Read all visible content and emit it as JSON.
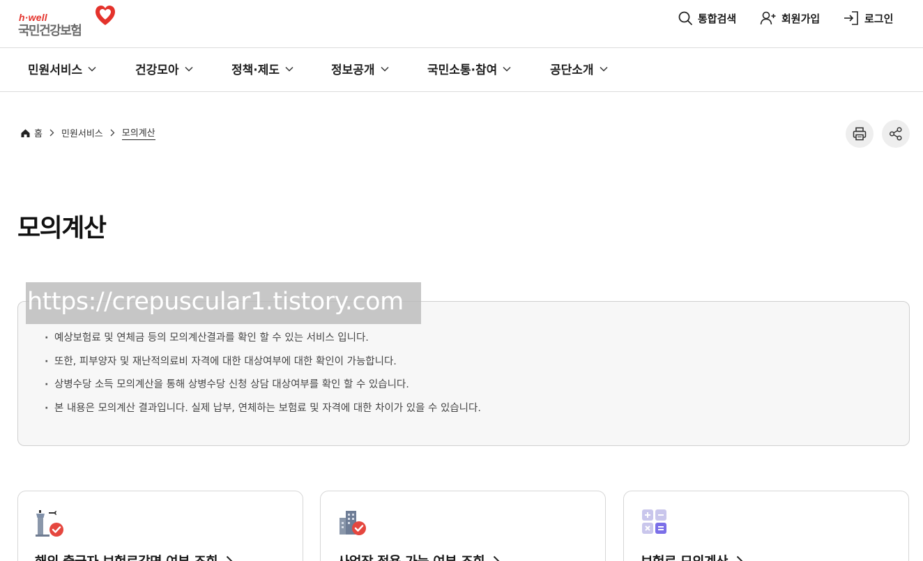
{
  "logo": {
    "sub": "h·well",
    "name": "국민건강보험"
  },
  "util": {
    "search": "통합검색",
    "join": "회원가입",
    "login": "로그인"
  },
  "gnb": [
    "민원서비스",
    "건강모아",
    "정책·제도",
    "정보공개",
    "국민소통·참여",
    "공단소개"
  ],
  "breadcrumb": {
    "home": "홈",
    "level1": "민원서비스",
    "current": "모의계산"
  },
  "page": {
    "title": "모의계산"
  },
  "watermark": "https://crepuscular1.tistory.com",
  "info": [
    "예상보험료 및 연체금 등의 모의계산결과를 확인 할 수 있는 서비스 입니다.",
    "또한, 피부양자 및 재난적의료비 자격에 대한 대상여부에 대한 확인이 가능합니다.",
    "상병수당 소득 모의계산을 통해 상병수당 신청 상담 대상여부를 확인 할 수 있습니다.",
    "본 내용은 모의계산 결과입니다. 실제 납부, 연체하는 보험료 및 자격에 대한 차이가 있을 수 있습니다."
  ],
  "cards": [
    {
      "title": "해외 출국자 보험료감면 여부 조회",
      "icon": "airport-tower-check-icon"
    },
    {
      "title": "사업장 적용 가능 여부 조회",
      "icon": "building-check-icon"
    },
    {
      "title": "보험료 모의계산",
      "icon": "calculator-icon"
    }
  ],
  "colors": {
    "brand_red": "#e4322b",
    "accent_purple": "#7b6fe8",
    "text": "#1a1a1a"
  }
}
